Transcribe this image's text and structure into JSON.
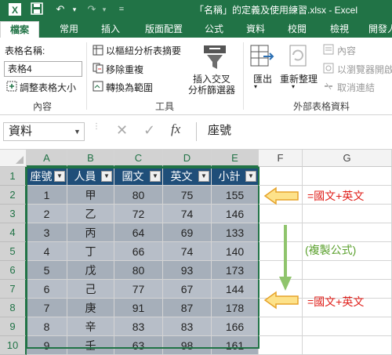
{
  "window": {
    "title": "「名稱」的定義及使用練習.xlsx - Excel"
  },
  "quick_access": {
    "save": "save-icon",
    "undo": "undo-icon",
    "redo": "redo-icon"
  },
  "tabs": [
    "檔案",
    "常用",
    "插入",
    "版面配置",
    "公式",
    "資料",
    "校閱",
    "檢視",
    "開發人"
  ],
  "ribbon": {
    "table_name_label": "表格名稱:",
    "table_name_value": "表格4",
    "resize_table": "調整表格大小",
    "summarize_pivot": "以樞紐分析表摘要",
    "remove_duplicates": "移除重複",
    "convert_to_range": "轉換為範圍",
    "insert_slicer_line1": "插入交叉",
    "insert_slicer_line2": "分析篩選器",
    "export": "匯出",
    "refresh": "重新整理",
    "properties": "內容",
    "open_in_browser": "以瀏覽器開啟",
    "unlink": "取消連結",
    "group_properties": "內容",
    "group_tools": "工具",
    "group_external": "外部表格資料"
  },
  "formula_bar": {
    "name_box": "資料",
    "formula": "座號",
    "fx": "fx"
  },
  "columns": [
    "A",
    "B",
    "C",
    "D",
    "E",
    "F",
    "G"
  ],
  "rows": [
    "1",
    "2",
    "3",
    "4",
    "5",
    "6",
    "7",
    "8",
    "9",
    "10"
  ],
  "table": {
    "headers": [
      "座號",
      "人員",
      "國文",
      "英文",
      "小計"
    ],
    "rows": [
      [
        "1",
        "甲",
        "80",
        "75",
        "155"
      ],
      [
        "2",
        "乙",
        "72",
        "74",
        "146"
      ],
      [
        "3",
        "丙",
        "64",
        "69",
        "133"
      ],
      [
        "4",
        "丁",
        "66",
        "74",
        "140"
      ],
      [
        "5",
        "戊",
        "80",
        "93",
        "173"
      ],
      [
        "6",
        "己",
        "77",
        "67",
        "144"
      ],
      [
        "7",
        "庚",
        "91",
        "87",
        "178"
      ],
      [
        "8",
        "辛",
        "83",
        "83",
        "166"
      ],
      [
        "9",
        "壬",
        "63",
        "98",
        "161"
      ]
    ]
  },
  "annotations": {
    "formula_top": "=國文+英文",
    "copy_note": "(複製公式)",
    "formula_bottom": "=國文+英文",
    "formula_color": "#e0201b",
    "note_color": "#5aa02c",
    "arrow_fill": "#fde28a",
    "arrow_stroke": "#e6a32b"
  },
  "colors": {
    "excel_green": "#217346",
    "table_header": "#1f4e79",
    "table_body": "#a6afba"
  }
}
